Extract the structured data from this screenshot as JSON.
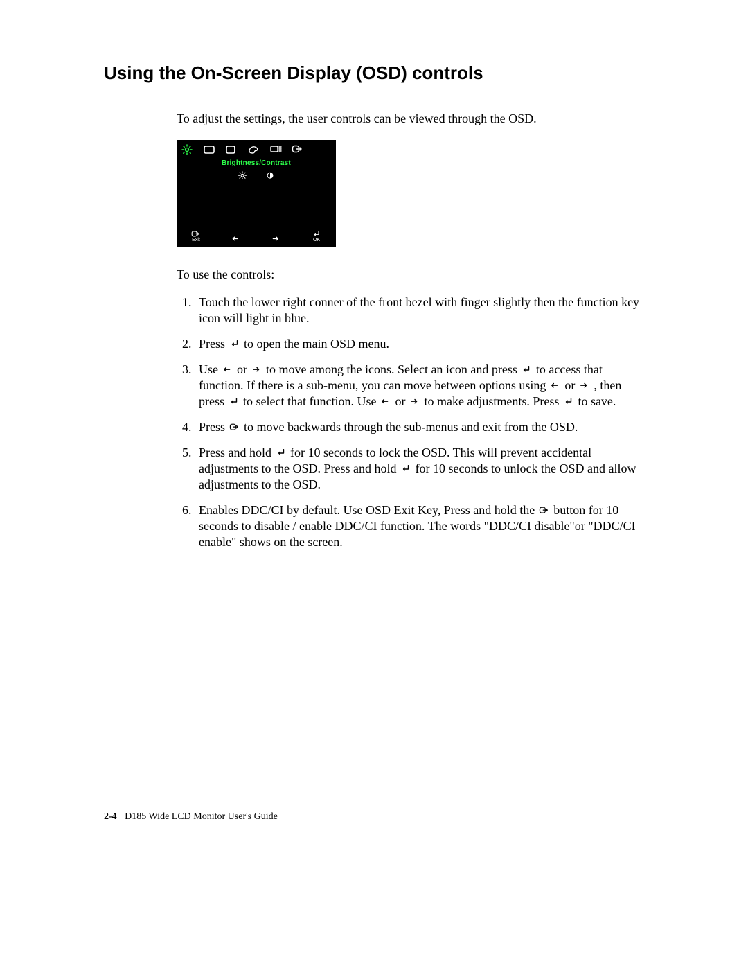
{
  "heading": "Using the On-Screen Display (OSD) controls",
  "intro": "To adjust the settings, the user controls can be viewed through the OSD.",
  "osd": {
    "title": "Brightness/Contrast",
    "tabs": [
      {
        "name": "brightness-icon",
        "active": true
      },
      {
        "name": "position-icon",
        "active": false
      },
      {
        "name": "image-setup-icon",
        "active": false
      },
      {
        "name": "image-props-icon",
        "active": false
      },
      {
        "name": "options-icon",
        "active": false
      },
      {
        "name": "exit-icon",
        "active": false
      }
    ],
    "sub": [
      {
        "name": "sun-icon"
      },
      {
        "name": "contrast-icon"
      }
    ],
    "footer": {
      "exit": {
        "glyph": "exit",
        "label": "Exit"
      },
      "left": {
        "glyph": "left",
        "label": ""
      },
      "right": {
        "glyph": "right",
        "label": ""
      },
      "ok": {
        "glyph": "enter",
        "label": "OK"
      }
    }
  },
  "lead2": "To use the controls:",
  "steps": [
    {
      "segments": [
        {
          "t": "Touch the lower right conner of the front bezel with finger slightly then the function key icon will light in blue."
        }
      ]
    },
    {
      "segments": [
        {
          "t": "Press "
        },
        {
          "g": "enter"
        },
        {
          "t": " to open the main OSD menu."
        }
      ]
    },
    {
      "segments": [
        {
          "t": "Use "
        },
        {
          "g": "left"
        },
        {
          "t": " or "
        },
        {
          "g": "right"
        },
        {
          "t": " to move among the icons. Select an icon and press  "
        },
        {
          "g": "enter"
        },
        {
          "t": " to access that function. If there is a sub-menu, you can move between options using "
        },
        {
          "g": "left"
        },
        {
          "t": " or "
        },
        {
          "g": "right"
        },
        {
          "t": " , then press  "
        },
        {
          "g": "enter"
        },
        {
          "t": " to select that function. Use "
        },
        {
          "g": "left"
        },
        {
          "t": " or "
        },
        {
          "g": "right"
        },
        {
          "t": " to make adjustments. Press "
        },
        {
          "g": "enter"
        },
        {
          "t": "  to save."
        }
      ]
    },
    {
      "segments": [
        {
          "t": "Press   "
        },
        {
          "g": "exit"
        },
        {
          "t": "  to move backwards through the sub-menus and exit from the OSD."
        }
      ]
    },
    {
      "segments": [
        {
          "t": "Press and hold  "
        },
        {
          "g": "enter"
        },
        {
          "t": "  for 10 seconds to lock the OSD. This will prevent accidental adjustments to the OSD. Press and hold "
        },
        {
          "g": "enter"
        },
        {
          "t": "  for 10  seconds to unlock the OSD and allow adjustments to the OSD."
        }
      ]
    },
    {
      "segments": [
        {
          "t": "Enables DDC/CI by default. Use OSD Exit Key, Press and hold the "
        },
        {
          "g": "exit"
        },
        {
          "t": " button for 10 seconds to disable / enable DDC/CI function. The words \"DDC/CI disable\"or \"DDC/CI enable\" shows on the screen."
        }
      ]
    }
  ],
  "footer": {
    "page": "2-4",
    "title": "D185 Wide LCD Monitor User's Guide"
  }
}
